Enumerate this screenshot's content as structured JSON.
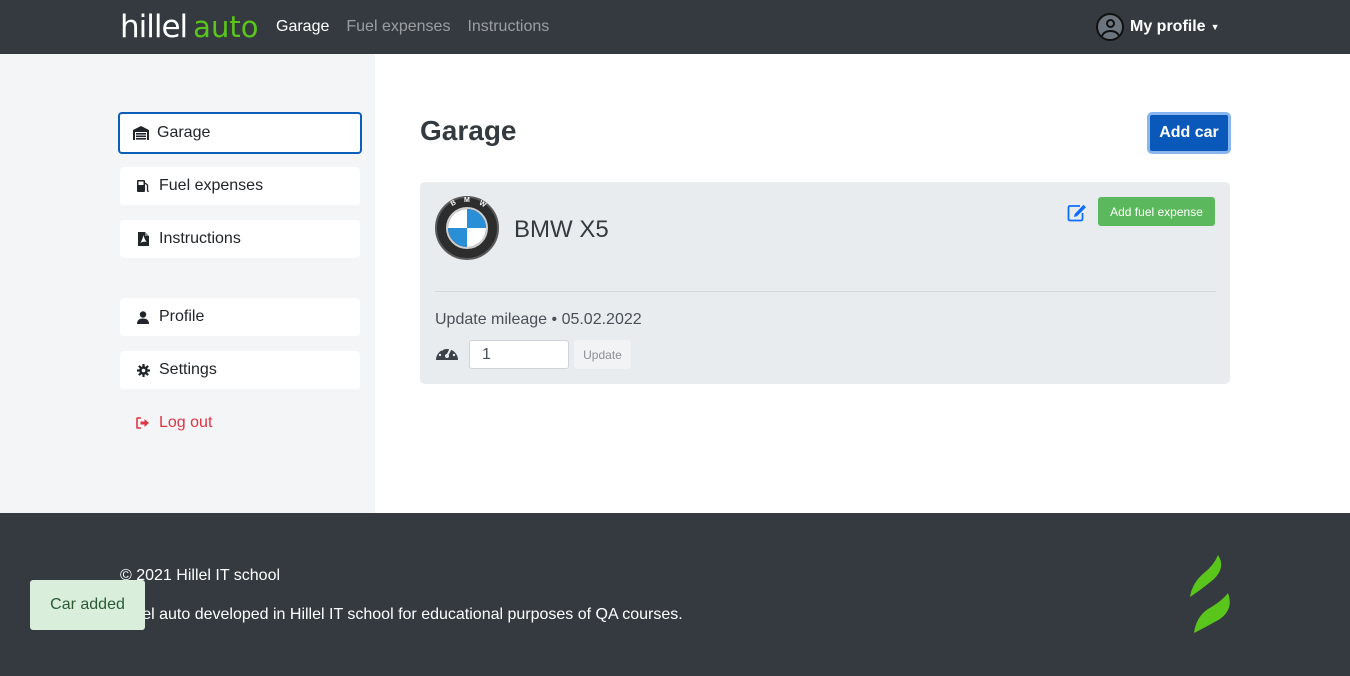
{
  "header": {
    "logo_main": "hillel",
    "logo_accent": "auto",
    "nav": [
      {
        "label": "Garage"
      },
      {
        "label": "Fuel expenses"
      },
      {
        "label": "Instructions"
      }
    ],
    "profile_label": "My profile"
  },
  "sidebar": {
    "items": [
      {
        "label": "Garage",
        "icon": "garage-icon"
      },
      {
        "label": "Fuel expenses",
        "icon": "fuel-pump-icon"
      },
      {
        "label": "Instructions",
        "icon": "pdf-file-icon"
      },
      {
        "label": "Profile",
        "icon": "user-icon"
      },
      {
        "label": "Settings",
        "icon": "gear-icon"
      },
      {
        "label": "Log out",
        "icon": "sign-out-icon"
      }
    ]
  },
  "main": {
    "title": "Garage",
    "add_car_label": "Add car",
    "car": {
      "name": "BMW X5",
      "add_fuel_label": "Add fuel expense",
      "mileage_label": "Update mileage • 05.02.2022",
      "mileage_value": "1",
      "update_label": "Update"
    }
  },
  "footer": {
    "copyright": "© 2021 Hillel IT school",
    "description": "Hillel auto developed in Hillel IT school for educational purposes of QA courses."
  },
  "toast": {
    "message": "Car added"
  },
  "colors": {
    "header_bg": "#343a40",
    "brand_green": "#5ac51a",
    "primary_blue": "#0a58ba",
    "success_green": "#5cb85c",
    "danger_red": "#dc3545"
  }
}
